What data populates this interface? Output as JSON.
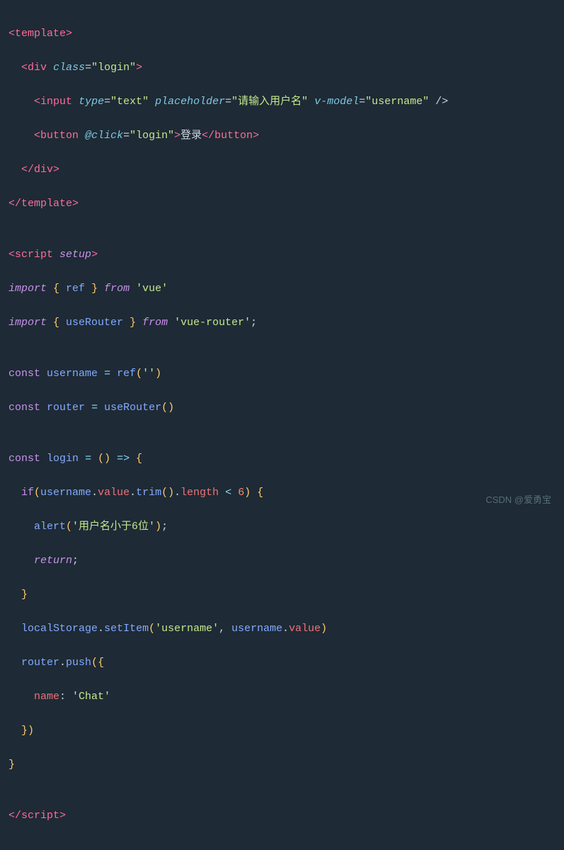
{
  "watermark": "CSDN @爱勇宝",
  "lines": [
    {
      "id": "l1"
    },
    {
      "id": "l2"
    },
    {
      "id": "l3"
    },
    {
      "id": "l4"
    },
    {
      "id": "l5"
    },
    {
      "id": "l6"
    },
    {
      "id": "l7"
    },
    {
      "id": "l8"
    },
    {
      "id": "l9"
    },
    {
      "id": "l10"
    },
    {
      "id": "l11"
    },
    {
      "id": "l12"
    },
    {
      "id": "l13"
    },
    {
      "id": "l14"
    },
    {
      "id": "l15"
    },
    {
      "id": "l16"
    },
    {
      "id": "l17"
    },
    {
      "id": "l18"
    },
    {
      "id": "l19"
    },
    {
      "id": "l20"
    },
    {
      "id": "l21"
    },
    {
      "id": "l22"
    },
    {
      "id": "l23"
    },
    {
      "id": "l24"
    },
    {
      "id": "l25"
    },
    {
      "id": "l26"
    },
    {
      "id": "l27"
    },
    {
      "id": "l28"
    },
    {
      "id": "l29"
    },
    {
      "id": "l30"
    }
  ]
}
